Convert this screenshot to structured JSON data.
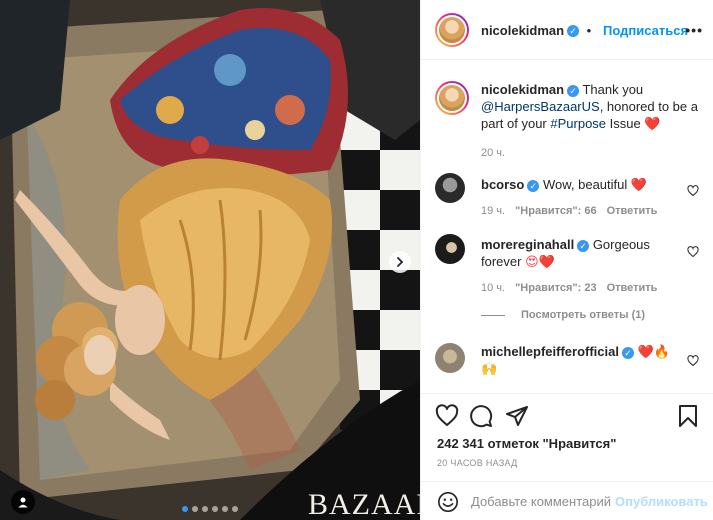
{
  "post": {
    "photo_watermark": "BAZAAR",
    "carousel_dots": 6,
    "carousel_active": 0
  },
  "header": {
    "username": "nicolekidman",
    "follow_label": "Подписаться",
    "more_label": "•••"
  },
  "caption": {
    "username": "nicolekidman",
    "text_before": " Thank you ",
    "mention": "@HarpersBazaarUS",
    "text_middle": ", honored to be a part of your ",
    "hashtag": "#Purpose",
    "text_after": " Issue",
    "emoji": "❤️",
    "time": "20 ч."
  },
  "comments": [
    {
      "username": "bcorso",
      "text": " Wow, beautiful ",
      "emoji": "❤️",
      "time": "19 ч.",
      "likes": "\"Нравится\": 66",
      "reply": "Ответить"
    },
    {
      "username": "morereginahall",
      "text": " Gorgeous forever ",
      "emoji": "😍❤️",
      "time": "10 ч.",
      "likes": "\"Нравится\": 23",
      "reply": "Ответить"
    },
    {
      "username": "michellepfeifferofficial",
      "text": " ",
      "emoji": "❤️🔥🙌",
      "time": "",
      "likes": "",
      "reply": ""
    }
  ],
  "view_replies": "Посмотреть ответы (1)",
  "actions": {
    "likes_text": "242 341 отметок \"Нравится\"",
    "timestamp": "20 ЧАСОВ НАЗАД"
  },
  "add_comment": {
    "placeholder": "Добавьте комментарий...",
    "publish_label": "Опубликовать"
  },
  "colors": {
    "accent": "#0095f6",
    "verified": "#3897f0",
    "heart_red": "#ed4956"
  }
}
